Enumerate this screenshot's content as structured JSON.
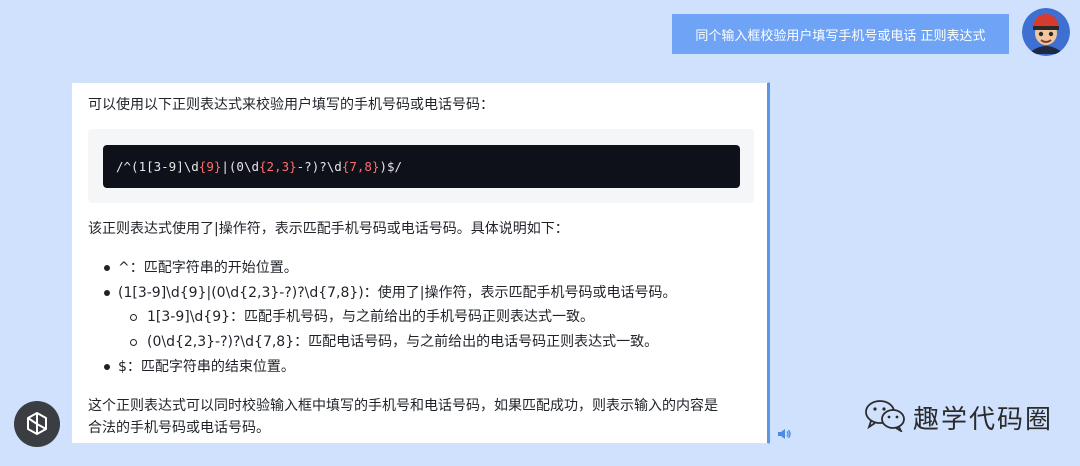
{
  "user": {
    "message": "同个输入框校验用户填写手机号或电话 正则表达式"
  },
  "reply": {
    "intro": "可以使用以下正则表达式来校验用户填写的手机号码或电话号码：",
    "code_parts": [
      "/^(1[3-9]\\d",
      "{9}",
      "|(0\\d",
      "{2,3}",
      "-?)?\\d",
      "{7,8}",
      ")$/"
    ],
    "explain": "该正则表达式使用了|操作符，表示匹配手机号码或电话号码。具体说明如下：",
    "bullets": [
      "^：匹配字符串的开始位置。",
      "(1[3-9]\\d{9}|(0\\d{2,3}-?)?\\d{7,8})：使用了|操作符，表示匹配手机号码或电话号码。",
      "$：匹配字符串的结束位置。"
    ],
    "sub_bullets": [
      "1[3-9]\\d{9}：匹配手机号码，与之前给出的手机号码正则表达式一致。",
      "(0\\d{2,3}-?)?\\d{7,8}：匹配电话号码，与之前给出的电话号码正则表达式一致。"
    ],
    "conclusion_line1": "这个正则表达式可以同时校验输入框中填写的手机号和电话号码，如果匹配成功，则表示输入的内容是",
    "conclusion_line2": "合法的手机号码或电话号码。"
  },
  "icons": {
    "user_avatar": "user-avatar-icon",
    "bot_avatar": "openai-logo-icon",
    "speaker": "speaker-icon",
    "watermark": "wechat-icon"
  },
  "watermark": {
    "text": "趣学代码圈"
  },
  "colors": {
    "background": "#cfe1fd",
    "user_bubble": "#6ea3f5",
    "code_bg": "#0f111a",
    "code_number": "#ff6b6b",
    "card_border_accent": "#5b95ea"
  }
}
